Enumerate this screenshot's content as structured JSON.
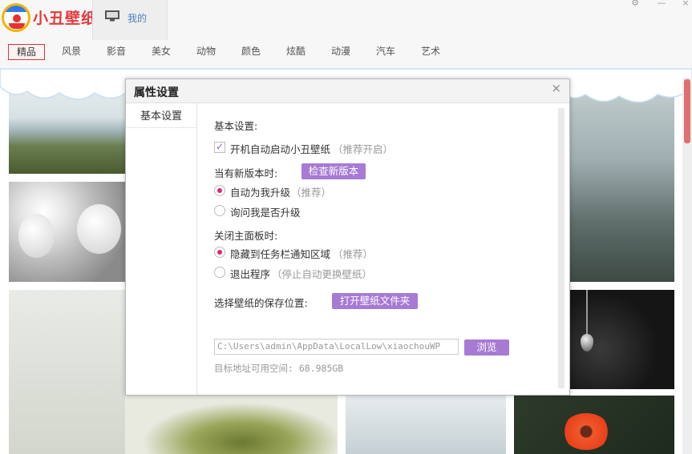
{
  "app": {
    "name": "小丑壁纸",
    "my_tab": "我的"
  },
  "categories": [
    "精品",
    "风景",
    "影音",
    "美女",
    "动物",
    "颜色",
    "炫酷",
    "动漫",
    "汽车",
    "艺术"
  ],
  "active_category": "精品",
  "dialog": {
    "title": "属性设置",
    "close": "×",
    "sidebar": [
      "基本设置"
    ],
    "basic": {
      "heading": "基本设置:",
      "autostart_label": "开机自动启动小丑壁纸",
      "autostart_hint": "（推荐开启）",
      "autostart_checked": true
    },
    "update": {
      "heading": "当有新版本时:",
      "check_button": "检查新版本",
      "auto_label": "自动为我升级",
      "auto_hint": "（推荐）",
      "ask_label": "询问我是否升级",
      "selected": "auto"
    },
    "close_panel": {
      "heading": "关闭主面板时:",
      "tray_label": "隐藏到任务栏通知区域",
      "tray_hint": "（推荐）",
      "exit_label": "退出程序",
      "exit_hint": "（停止自动更换壁纸）",
      "selected": "tray"
    },
    "save": {
      "heading": "选择壁纸的保存位置:",
      "open_button": "打开壁纸文件夹",
      "path_value": "C:\\Users\\admin\\AppData\\LocalLow\\xiaochouWP",
      "browse_button": "浏览",
      "free_space": "目标地址可用空间: 68.985GB"
    }
  },
  "colors": {
    "accent": "#a77ad4",
    "brand_red": "#e4393c",
    "radio_on": "#e0247a"
  }
}
